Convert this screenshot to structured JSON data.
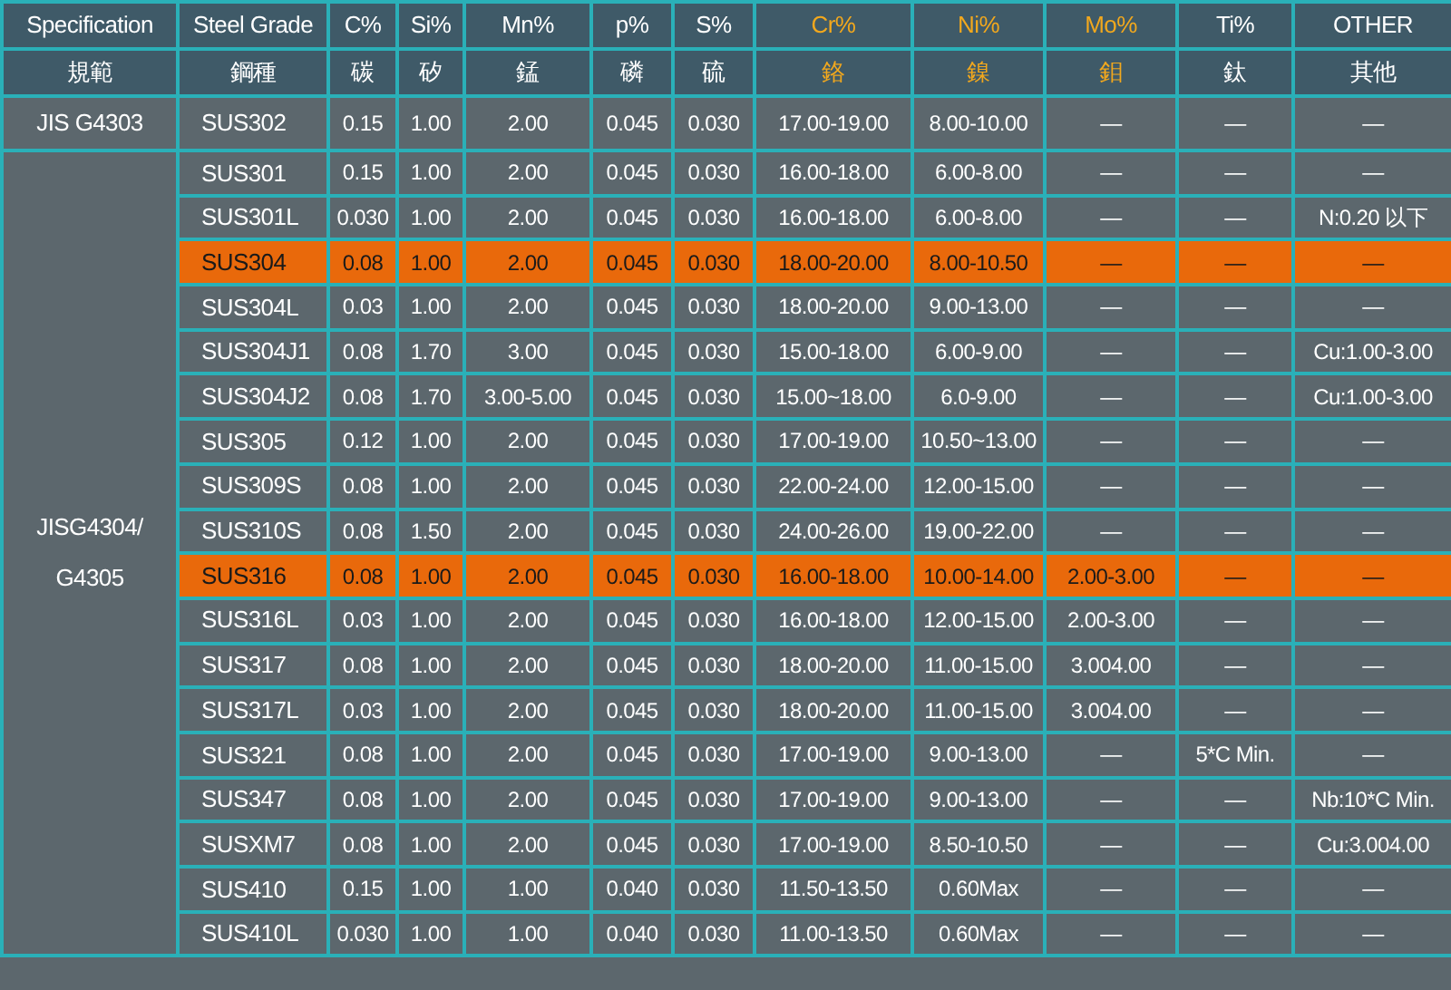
{
  "columns": [
    {
      "label": "Specification",
      "label_zh": "規範",
      "accent": false
    },
    {
      "label": "Steel Grade",
      "label_zh": "鋼種",
      "accent": false
    },
    {
      "label": "C%",
      "label_zh": "碳",
      "accent": false
    },
    {
      "label": "Si%",
      "label_zh": "矽",
      "accent": false
    },
    {
      "label": "Mn%",
      "label_zh": "錳",
      "accent": false
    },
    {
      "label": "p%",
      "label_zh": "磷",
      "accent": false
    },
    {
      "label": "S%",
      "label_zh": "硫",
      "accent": false
    },
    {
      "label": "Cr%",
      "label_zh": "鉻",
      "accent": true
    },
    {
      "label": "Ni%",
      "label_zh": "鎳",
      "accent": true
    },
    {
      "label": "Mo%",
      "label_zh": "鉬",
      "accent": true
    },
    {
      "label": "Ti%",
      "label_zh": "鈦",
      "accent": false
    },
    {
      "label": "OTHER",
      "label_zh": "其他",
      "accent": false
    }
  ],
  "groups": [
    {
      "specification": "JIS G4303",
      "rows": [
        {
          "highlighted": false,
          "cells": [
            "SUS302",
            "0.15",
            "1.00",
            "2.00",
            "0.045",
            "0.030",
            "17.00-19.00",
            "8.00-10.00",
            "—",
            "—",
            "—"
          ]
        }
      ]
    },
    {
      "specification": "JISG4304/ G4305",
      "rows": [
        {
          "highlighted": false,
          "cells": [
            "SUS301",
            "0.15",
            "1.00",
            "2.00",
            "0.045",
            "0.030",
            "16.00-18.00",
            "6.00-8.00",
            "—",
            "—",
            "—"
          ]
        },
        {
          "highlighted": false,
          "cells": [
            "SUS301L",
            "0.030",
            "1.00",
            "2.00",
            "0.045",
            "0.030",
            "16.00-18.00",
            "6.00-8.00",
            "—",
            "—",
            "N:0.20 以下"
          ]
        },
        {
          "highlighted": true,
          "cells": [
            "SUS304",
            "0.08",
            "1.00",
            "2.00",
            "0.045",
            "0.030",
            "18.00-20.00",
            "8.00-10.50",
            "—",
            "—",
            "—"
          ]
        },
        {
          "highlighted": false,
          "cells": [
            "SUS304L",
            "0.03",
            "1.00",
            "2.00",
            "0.045",
            "0.030",
            "18.00-20.00",
            "9.00-13.00",
            "—",
            "—",
            "—"
          ]
        },
        {
          "highlighted": false,
          "cells": [
            "SUS304J1",
            "0.08",
            "1.70",
            "3.00",
            "0.045",
            "0.030",
            "15.00-18.00",
            "6.00-9.00",
            "—",
            "—",
            "Cu:1.00-3.00"
          ]
        },
        {
          "highlighted": false,
          "cells": [
            "SUS304J2",
            "0.08",
            "1.70",
            "3.00-5.00",
            "0.045",
            "0.030",
            "15.00~18.00",
            "6.0-9.00",
            "—",
            "—",
            "Cu:1.00-3.00"
          ]
        },
        {
          "highlighted": false,
          "cells": [
            "SUS305",
            "0.12",
            "1.00",
            "2.00",
            "0.045",
            "0.030",
            "17.00-19.00",
            "10.50~13.00",
            "—",
            "—",
            "—"
          ]
        },
        {
          "highlighted": false,
          "cells": [
            "SUS309S",
            "0.08",
            "1.00",
            "2.00",
            "0.045",
            "0.030",
            "22.00-24.00",
            "12.00-15.00",
            "—",
            "—",
            "—"
          ]
        },
        {
          "highlighted": false,
          "cells": [
            "SUS310S",
            "0.08",
            "1.50",
            "2.00",
            "0.045",
            "0.030",
            "24.00-26.00",
            "19.00-22.00",
            "—",
            "—",
            "—"
          ]
        },
        {
          "highlighted": true,
          "cells": [
            "SUS316",
            "0.08",
            "1.00",
            "2.00",
            "0.045",
            "0.030",
            "16.00-18.00",
            "10.00-14.00",
            "2.00-3.00",
            "—",
            "—"
          ]
        },
        {
          "highlighted": false,
          "cells": [
            "SUS316L",
            "0.03",
            "1.00",
            "2.00",
            "0.045",
            "0.030",
            "16.00-18.00",
            "12.00-15.00",
            "2.00-3.00",
            "—",
            "—"
          ]
        },
        {
          "highlighted": false,
          "cells": [
            "SUS317",
            "0.08",
            "1.00",
            "2.00",
            "0.045",
            "0.030",
            "18.00-20.00",
            "11.00-15.00",
            "3.004.00",
            "—",
            "—"
          ]
        },
        {
          "highlighted": false,
          "cells": [
            "SUS317L",
            "0.03",
            "1.00",
            "2.00",
            "0.045",
            "0.030",
            "18.00-20.00",
            "11.00-15.00",
            "3.004.00",
            "—",
            "—"
          ]
        },
        {
          "highlighted": false,
          "cells": [
            "SUS321",
            "0.08",
            "1.00",
            "2.00",
            "0.045",
            "0.030",
            "17.00-19.00",
            "9.00-13.00",
            "—",
            "5*C Min.",
            "—"
          ]
        },
        {
          "highlighted": false,
          "cells": [
            "SUS347",
            "0.08",
            "1.00",
            "2.00",
            "0.045",
            "0.030",
            "17.00-19.00",
            "9.00-13.00",
            "—",
            "—",
            "Nb:10*C Min."
          ]
        },
        {
          "highlighted": false,
          "cells": [
            "SUSXM7",
            "0.08",
            "1.00",
            "2.00",
            "0.045",
            "0.030",
            "17.00-19.00",
            "8.50-10.50",
            "—",
            "—",
            "Cu:3.004.00"
          ]
        },
        {
          "highlighted": false,
          "cells": [
            "SUS410",
            "0.15",
            "1.00",
            "1.00",
            "0.040",
            "0.030",
            "11.50-13.50",
            "0.60Max",
            "—",
            "—",
            "—"
          ]
        },
        {
          "highlighted": false,
          "cells": [
            "SUS410L",
            "0.030",
            "1.00",
            "1.00",
            "0.040",
            "0.030",
            "11.00-13.50",
            "0.60Max",
            "—",
            "—",
            "—"
          ]
        }
      ]
    }
  ]
}
